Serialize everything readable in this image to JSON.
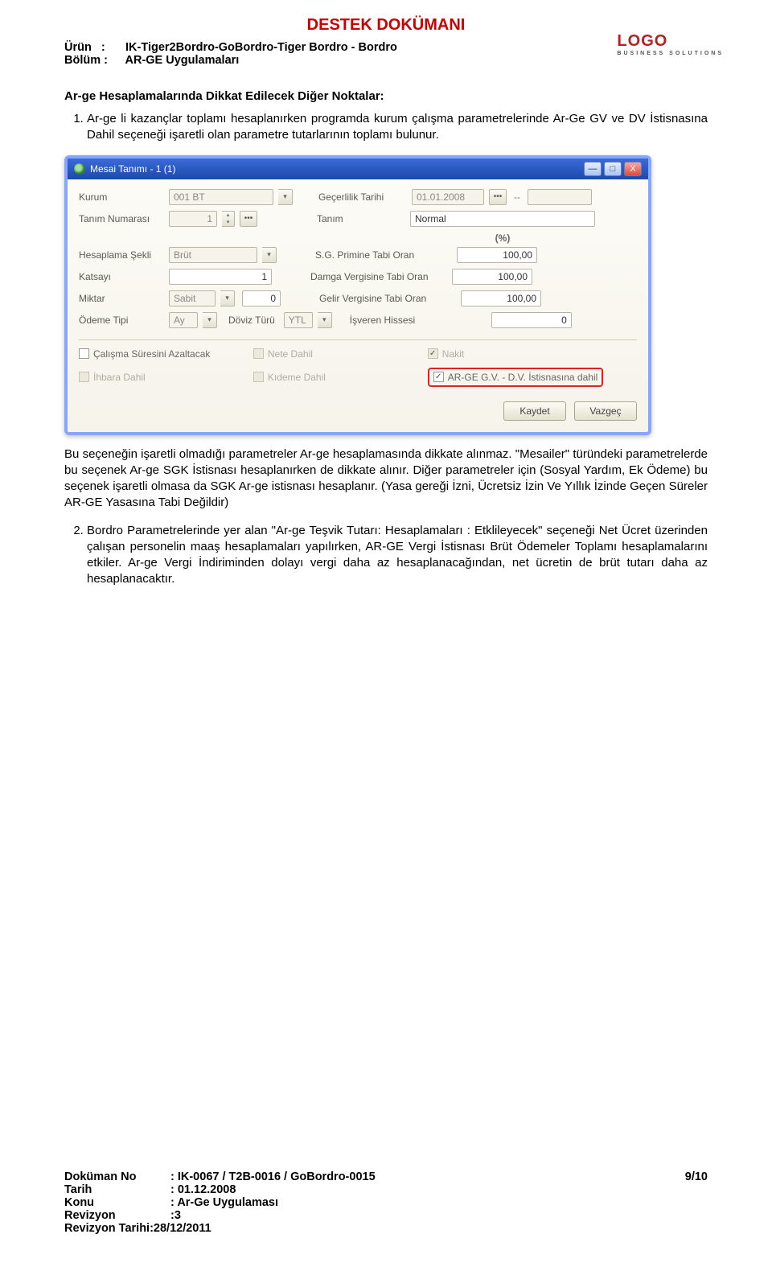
{
  "doc": {
    "title": "DESTEK DOKÜMANI",
    "meta": {
      "urun_label": "Ürün",
      "urun_value": "IK-Tiger2Bordro-GoBordro-Tiger Bordro - Bordro",
      "bolum_label": "Bölüm",
      "bolum_value": "AR-GE Uygulamaları"
    },
    "logo_text": "LOGO",
    "logo_sub": "BUSINESS SOLUTIONS"
  },
  "section_heading": "Ar-ge Hesaplamalarında Dikkat Edilecek Diğer Noktalar:",
  "list": {
    "item1": "Ar-ge li kazançlar toplamı hesaplanırken programda kurum çalışma parametrelerinde Ar-Ge GV ve DV İstisnasına Dahil seçeneği işaretli olan parametre tutarlarının toplamı bulunur.",
    "item2": "Bordro Parametrelerinde yer alan \"Ar-ge Teşvik Tutarı: Hesaplamaları : Etklileyecek\" seçeneği Net Ücret üzerinden çalışan personelin maaş hesaplamaları yapılırken, AR-GE Vergi İstisnası Brüt Ödemeler Toplamı hesaplamalarını etkiler. Ar-ge Vergi İndiriminden dolayı  vergi daha az hesaplanacağından, net ücretin de brüt tutarı daha az hesaplanacaktır."
  },
  "mid_para": "Bu seçeneğin işaretli olmadığı parametreler Ar-ge hesaplamasında dikkate alınmaz. \"Mesailer\" türündeki parametrelerde bu seçenek Ar-ge SGK İstisnası hesaplanırken de dikkate alınır. Diğer parametreler için (Sosyal Yardım, Ek  Ödeme) bu seçenek işaretli olmasa da SGK Ar-ge istisnası hesaplanır. (Yasa gereği İzni, Ücretsiz İzin Ve Yıllık İzinde Geçen Süreler AR-GE Yasasına Tabi Değildir)",
  "window": {
    "title": "Mesai Tanımı - 1 (1)",
    "controls": {
      "min": "—",
      "max": "□",
      "close": "X"
    },
    "labels": {
      "kurum": "Kurum",
      "gecerlilik": "Geçerlilik Tarihi",
      "tanim_no": "Tanım Numarası",
      "tanim": "Tanım",
      "percent": "(%)",
      "hesap_sekli": "Hesaplama Şekli",
      "sg_oran": "S.G. Primine Tabi Oran",
      "katsayi": "Katsayı",
      "damga_oran": "Damga Vergisine Tabi Oran",
      "miktar": "Miktar",
      "gelir_oran": "Gelir Vergisine Tabi Oran",
      "odeme_tipi": "Ödeme Tipi",
      "doviz_turu": "Döviz Türü",
      "isveren": "İşveren Hissesi"
    },
    "values": {
      "kurum": "001 BT",
      "tarih": "01.01.2008",
      "tarih_dash": "--",
      "tanim_no": "1",
      "tanim": "Normal",
      "hesap_sekli": "Brüt",
      "sg_oran": "100,00",
      "katsayi": "1",
      "damga_oran": "100,00",
      "miktar": "Sabit",
      "miktar_val": "0",
      "gelir_oran": "100,00",
      "odeme_tipi": "Ay",
      "doviz_turu": "YTL",
      "isveren": "0"
    },
    "checks": {
      "c1": "Çalışma Süresini Azaltacak",
      "c2": "Nete Dahil",
      "c3": "Nakit",
      "c4": "İhbara Dahil",
      "c5": "Kıdeme Dahil",
      "c6": "AR-GE G.V. - D.V. İstisnasına dahil"
    },
    "buttons": {
      "save": "Kaydet",
      "cancel": "Vazgeç"
    }
  },
  "footer": {
    "dokno_label": "Doküman No",
    "dokno_value": ": IK-0067 / T2B-0016 / GoBordro-0015",
    "tarih_label": "Tarih",
    "tarih_value": ": 01.12.2008",
    "konu_label": "Konu",
    "konu_value": ": Ar-Ge Uygulaması",
    "rev_label": "Revizyon",
    "rev_value": ":3",
    "revt": "Revizyon Tarihi:28/12/2011",
    "pageno": "9/10"
  }
}
